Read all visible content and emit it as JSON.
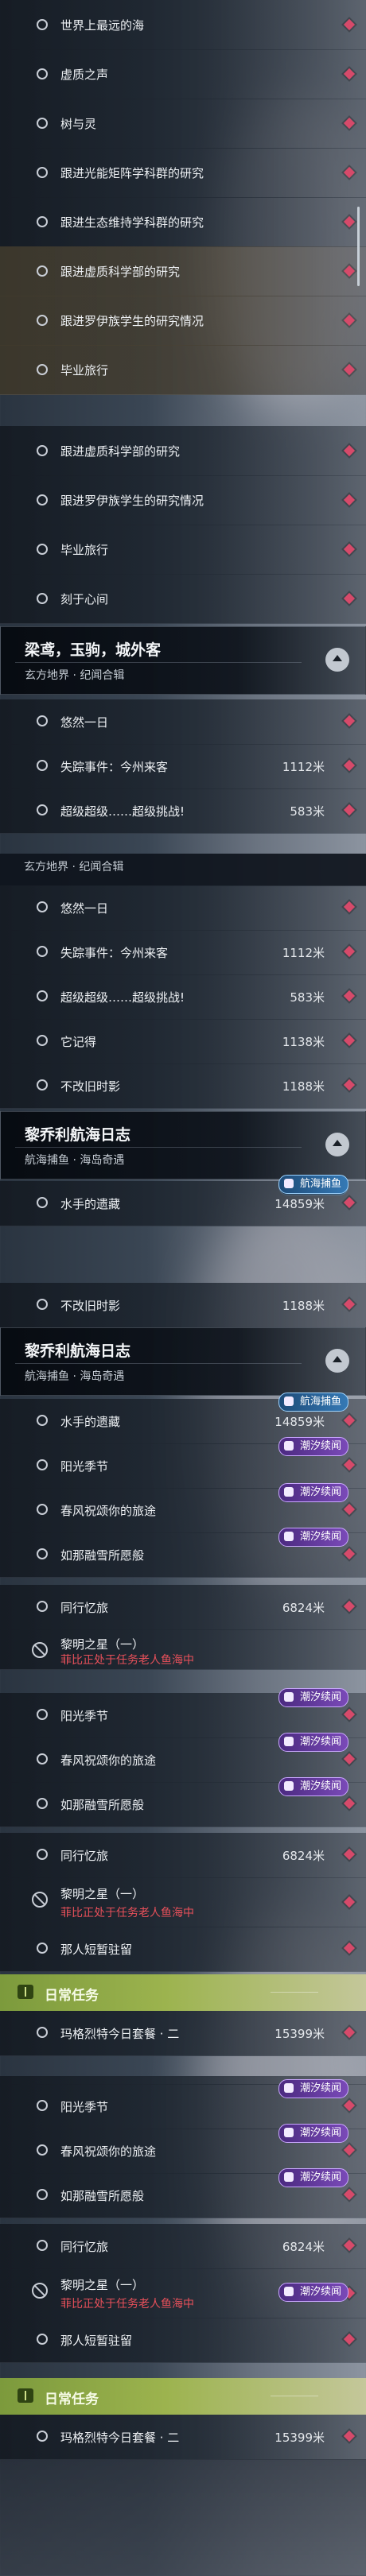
{
  "colors": {
    "accent_red": "#e8505a",
    "marker": "#d64a6a",
    "tag_purple": "#7a4ab8",
    "tag_blue": "#3579b5",
    "daily_green": "#9cb34e"
  },
  "quests": {
    "q1": "世界上最远的海",
    "q2": "虚质之声",
    "q3": "树与灵",
    "q4": "跟进光能矩阵学科群的研究",
    "q5": "跟进生态维持学科群的研究",
    "q6": "跟进虚质科学部的研究",
    "q7": "跟进罗伊族学生的研究情况",
    "q8": "毕业旅行",
    "q9": "刻于心间",
    "q10": "悠然一日",
    "q11": "失踪事件：今州来客",
    "q12": "超级超级……超级挑战!",
    "q13": "它记得",
    "q14": "不改旧时影",
    "q15": "水手的遗藏",
    "q16": "阳光季节",
    "q17": "春风祝颂你的旅途",
    "q18": "如那融雪所愿般",
    "q19": "同行忆旅",
    "q20": "黎明之星（一）",
    "q20_sub": "菲比正处于任务老人鱼海中",
    "q21": "那人短暂驻留",
    "q22": "玛格烈特今日套餐 · 二"
  },
  "dist": {
    "d1112": "1112米",
    "d583": "583米",
    "d1138": "1138米",
    "d1188": "1188米",
    "d14859": "14859米",
    "d6824": "6824米",
    "d15399": "15399米"
  },
  "groups": {
    "g1_title": "梁鸢，玉驹，城外客",
    "g1_sub": "玄方地界 · 纪闻合辑",
    "g1_sub_partial": "玄方地界 · 纪闻合辑",
    "g2_title": "黎乔利航海日志",
    "g2_sub": "航海捕鱼 · 海岛奇遇"
  },
  "tags": {
    "fishing": "航海捕鱼",
    "tide": "潮汐续闻"
  },
  "daily": {
    "title": "日常任务"
  }
}
